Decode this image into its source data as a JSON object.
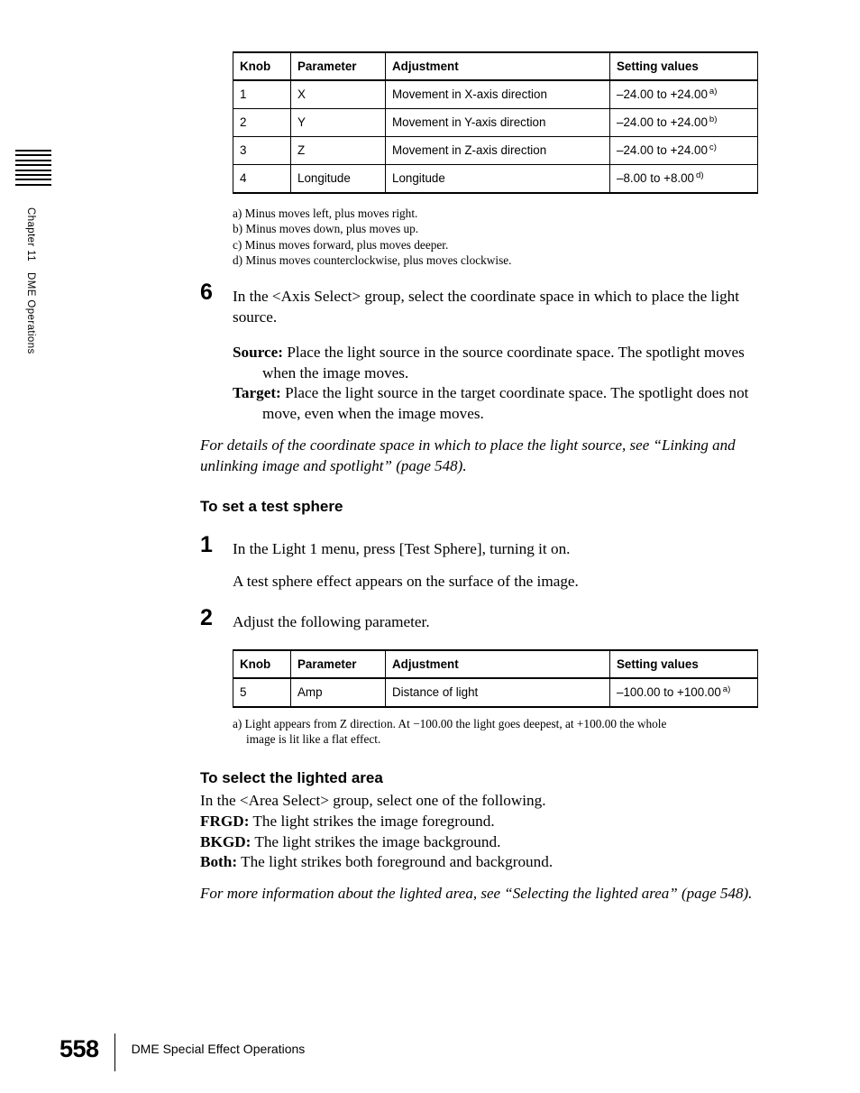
{
  "margin": {
    "chapter_label_part1": "Chapter 11",
    "chapter_label_part2": "DME Operations"
  },
  "table1": {
    "headers": [
      "Knob",
      "Parameter",
      "Adjustment",
      "Setting values"
    ],
    "rows": [
      {
        "knob": "1",
        "parameter": "X",
        "adjustment": "Movement in X-axis direction",
        "setting": "–24.00 to +24.00",
        "footnote": "a)"
      },
      {
        "knob": "2",
        "parameter": "Y",
        "adjustment": "Movement in Y-axis direction",
        "setting": "–24.00 to +24.00",
        "footnote": "b)"
      },
      {
        "knob": "3",
        "parameter": "Z",
        "adjustment": "Movement in Z-axis direction",
        "setting": "–24.00 to +24.00",
        "footnote": "c)"
      },
      {
        "knob": "4",
        "parameter": "Longitude",
        "adjustment": "Longitude",
        "setting": "–8.00 to +8.00",
        "footnote": "d)"
      }
    ],
    "footnotes": [
      "a) Minus moves left, plus moves right.",
      "b) Minus moves down, plus moves up.",
      "c) Minus moves forward, plus moves deeper.",
      "d) Minus moves counterclockwise, plus moves clockwise."
    ]
  },
  "step6": {
    "number": "6",
    "text": "In the <Axis Select> group, select the coordinate space in which to place the light source.",
    "definitions": [
      {
        "term": "Source:",
        "desc": "Place the light source in the source coordinate space. The spotlight moves when the image moves."
      },
      {
        "term": "Target:",
        "desc": "Place the light source in the target coordinate space. The spotlight does not move, even when the image moves."
      }
    ],
    "note": "For details of the coordinate space in which to place the light source, see “Linking and unlinking image and spotlight” (page 548)."
  },
  "section_test_sphere": {
    "heading": "To set a test sphere",
    "step1": {
      "number": "1",
      "text": "In the Light 1 menu, press [Test Sphere], turning it on.",
      "result": "A test sphere effect appears on the surface of the image."
    },
    "step2": {
      "number": "2",
      "text": "Adjust the following parameter."
    }
  },
  "table2": {
    "headers": [
      "Knob",
      "Parameter",
      "Adjustment",
      "Setting values"
    ],
    "rows": [
      {
        "knob": "5",
        "parameter": "Amp",
        "adjustment": "Distance of light",
        "setting": "–100.00 to +100.00",
        "footnote": "a)"
      }
    ],
    "footnote_line1": "a) Light appears from Z direction. At −100.00 the light goes deepest, at +100.00 the whole",
    "footnote_line2": "image is lit like a flat effect."
  },
  "section_lighted_area": {
    "heading": "To select the lighted area",
    "intro": "In the <Area Select> group, select one of the following.",
    "options": [
      {
        "term": "FRGD:",
        "desc": "The light strikes the image foreground."
      },
      {
        "term": "BKGD:",
        "desc": "The light strikes the image background."
      },
      {
        "term": "Both:",
        "desc": "The light strikes both foreground and background."
      }
    ],
    "note": "For more information about the lighted area, see “Selecting the lighted area” (page 548)."
  },
  "footer": {
    "page_number": "558",
    "title": "DME Special Effect Operations"
  }
}
